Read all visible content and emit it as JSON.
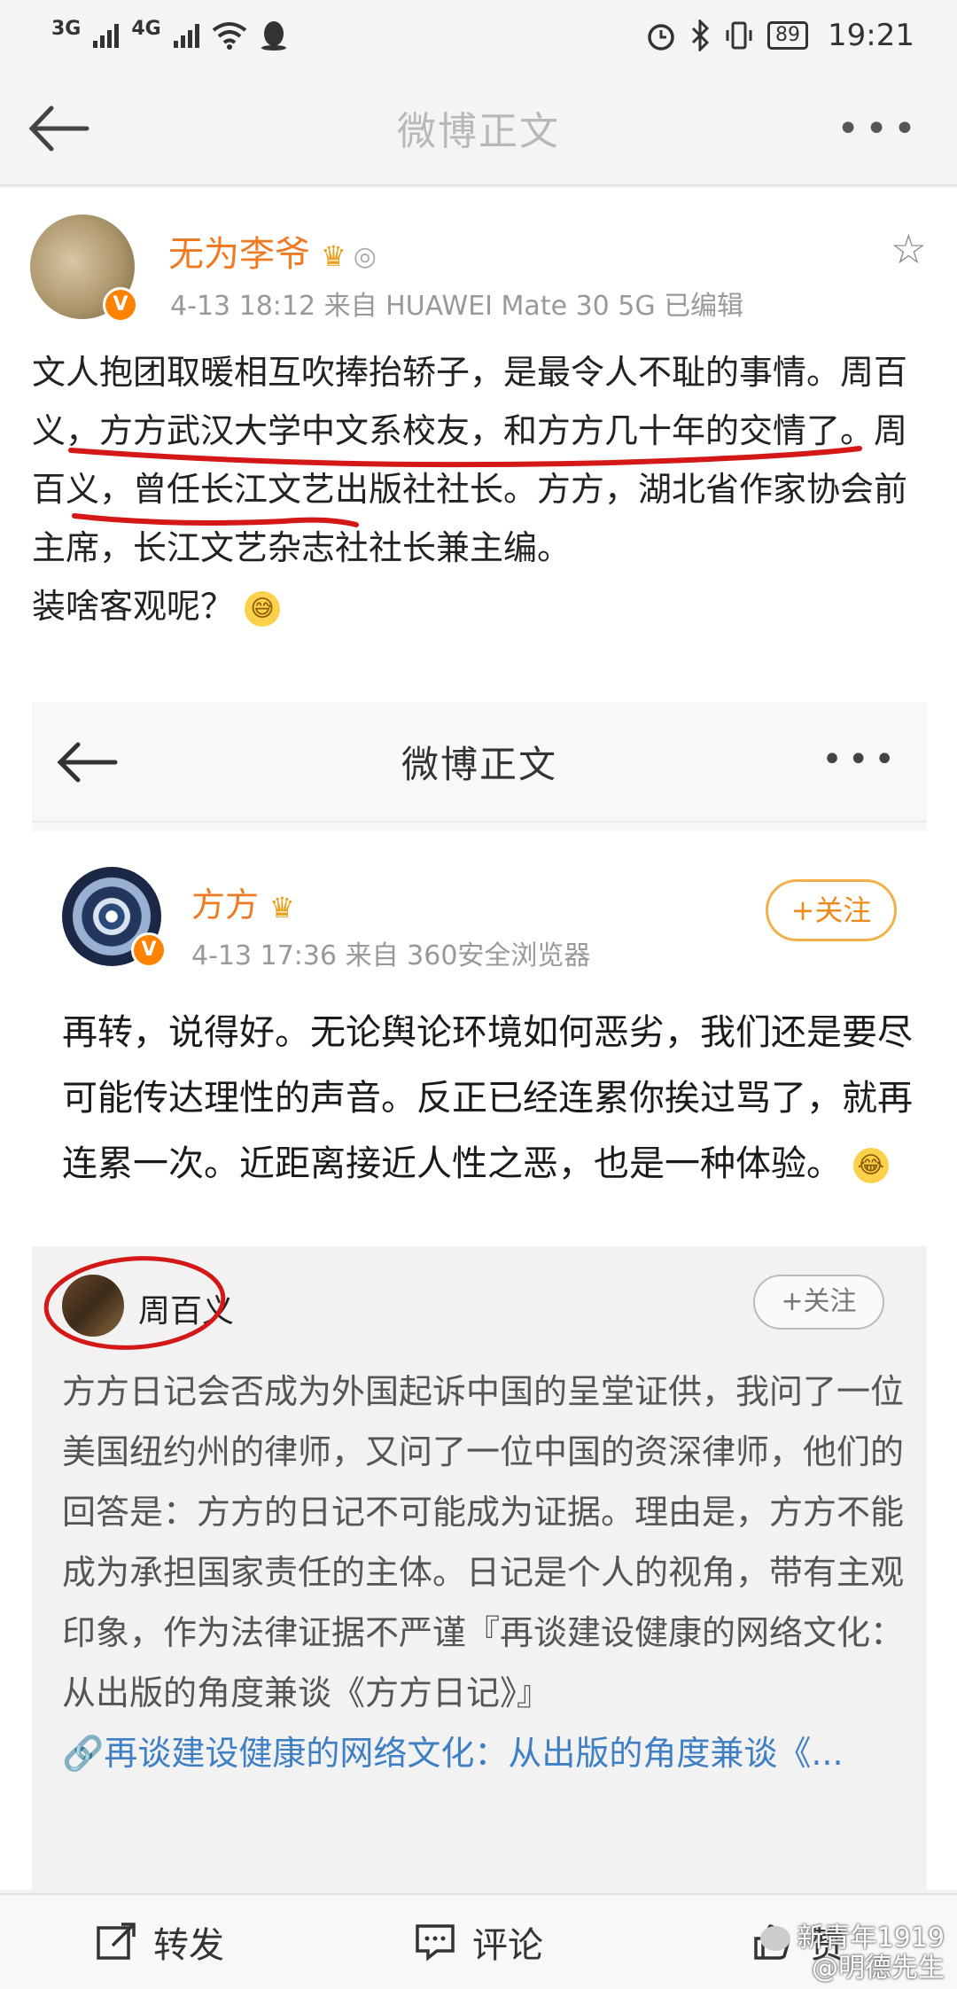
{
  "status": {
    "signal1": "3G",
    "signal2": "4G",
    "battery": "89",
    "time": "19:21"
  },
  "top_bar": {
    "title": "微博正文"
  },
  "post": {
    "author": "无为李爷",
    "meta": "4-13 18:12  来自 HUAWEI Mate 30 5G  已编辑",
    "body": "文人抱团取暖相互吹捧抬轿子，是最令人不耻的事情。周百义，方方武汉大学中文系校友，和方方几十年的交情了。周百义，曾任长江文艺出版社社长。方方，湖北省作家协会前主席，长江文艺杂志社社长兼主编。",
    "body_end": "装啥客观呢？",
    "badge": "V"
  },
  "embedded": {
    "title": "微博正文",
    "author": "方方",
    "meta": "4-13 17:36  来自 360安全浏览器",
    "follow_label": "+关注",
    "body": "再转，说得好。无论舆论环境如何恶劣，我们还是要尽可能传达理性的声音。反正已经连累你挨过骂了，就再连累一次。近距离接近人性之恶，也是一种体验。",
    "quote": {
      "author": "周百义",
      "follow_label": "+关注",
      "body": "方方日记会否成为外国起诉中国的呈堂证供，我问了一位美国纽约州的律师，又问了一位中国的资深律师，他们的回答是：方方的日记不可能成为证据。理由是，方方不能成为承担国家责任的主体。日记是个人的视角，带有主观印象，作为法律证据不严谨『再谈建设健康的网络文化：从出版的角度兼谈《方方日记》』",
      "link": "🔗再谈建设健康的网络文化：从出版的角度兼谈《..."
    }
  },
  "bottom_bar": {
    "repost": "转发",
    "comment": "评论",
    "like": "赞"
  },
  "watermark": {
    "line1": "新青年1919",
    "line2": "@明德先生"
  },
  "colors": {
    "accent": "#ee7b24",
    "annotation_red": "#d41818",
    "link": "#3f7fc4"
  }
}
